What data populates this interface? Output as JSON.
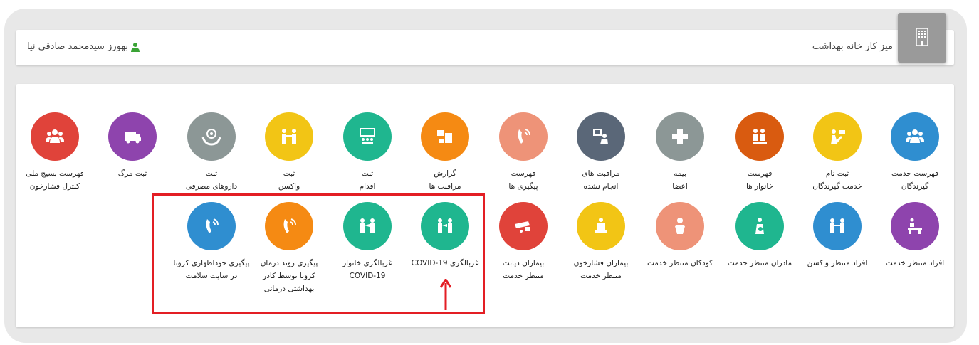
{
  "header": {
    "title": "میز کار خانه بهداشت",
    "user": "بهورز سیدمحمد صادقی نیا"
  },
  "tiles_row1": [
    {
      "label": "فهرست خدمت\nگیرندگان",
      "color": "#2f8ed0",
      "icon": "people-group-icon"
    },
    {
      "label": "ثبت نام\nخدمت گیرندگان",
      "color": "#f2c515",
      "icon": "register-person-icon"
    },
    {
      "label": "فهرست\nخانوار ها",
      "color": "#d95b10",
      "icon": "family-icon"
    },
    {
      "label": "بیمه\nاعضا",
      "color": "#8c9796",
      "icon": "medical-cross-icon"
    },
    {
      "label": "مراقبت های\nانجام نشده",
      "color": "#5a6778",
      "icon": "care-pending-icon"
    },
    {
      "label": "فهرست\nپیگیری ها",
      "color": "#ee9378",
      "icon": "phone-icon"
    },
    {
      "label": "گزارش\nمراقبت ها",
      "color": "#f58a13",
      "icon": "report-icon"
    },
    {
      "label": "ثبت\nاقدام",
      "color": "#1fb68f",
      "icon": "action-icon"
    },
    {
      "label": "ثبت\nواکسن",
      "color": "#f2c515",
      "icon": "vaccine-icon"
    },
    {
      "label": "ثبت\nداروهای مصرفی",
      "color": "#8c9796",
      "icon": "medicine-hand-icon"
    },
    {
      "label": "ثبت مرگ",
      "color": "#8e44ad",
      "icon": "ambulance-icon"
    },
    {
      "label": "فهرست بسیج ملی\nکنترل فشارخون",
      "color": "#e0433a",
      "icon": "people-group-icon"
    }
  ],
  "tiles_row2": [
    {
      "label": "افراد منتظر خدمت",
      "color": "#8e44ad",
      "icon": "waiting-person-icon"
    },
    {
      "label": "افراد منتظر واکسن",
      "color": "#2f8ed0",
      "icon": "vaccine-icon"
    },
    {
      "label": "مادران منتظر خدمت",
      "color": "#1fb68f",
      "icon": "mother-icon"
    },
    {
      "label": "کودکان منتظر خدمت",
      "color": "#ee9378",
      "icon": "child-icon"
    },
    {
      "label": "بیماران فشارخون\nمنتظر خدمت",
      "color": "#f2c515",
      "icon": "blood-pressure-icon"
    },
    {
      "label": "بیماران دیابت\nمنتظر خدمت",
      "color": "#e0433a",
      "icon": "diabetes-icon"
    },
    {
      "label": "غربالگری COVID-19",
      "color": "#1fb68f",
      "icon": "screening-icon"
    },
    {
      "label": "غربالگری خانوار\nCOVID-19",
      "color": "#1fb68f",
      "icon": "screening-icon"
    },
    {
      "label": "پیگیری روند درمان\nکرونا توسط کادر\nبهداشتی درمانی",
      "color": "#f58a13",
      "icon": "phone-icon"
    },
    {
      "label": "پیگیری خوداظهاری کرونا\nدر سایت سلامت",
      "color": "#2f8ed0",
      "icon": "phone-icon"
    }
  ]
}
